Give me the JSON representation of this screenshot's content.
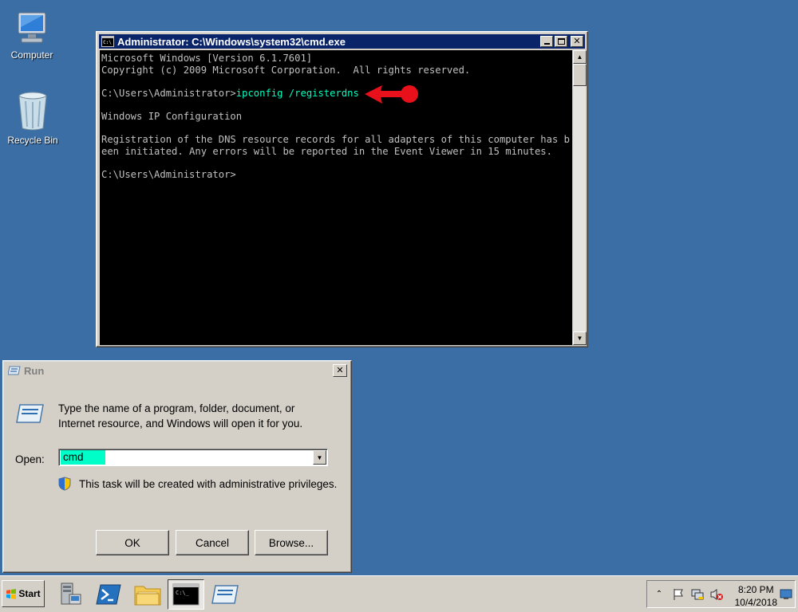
{
  "desktop": {
    "icons": [
      {
        "label": "Computer",
        "icon": "computer-icon"
      },
      {
        "label": "Recycle Bin",
        "icon": "recycle-bin-icon"
      }
    ]
  },
  "cmd_window": {
    "title": "Administrator: C:\\Windows\\system32\\cmd.exe",
    "lines": {
      "l1": "Microsoft Windows [Version 6.1.7601]",
      "l2": "Copyright (c) 2009 Microsoft Corporation.  All rights reserved.",
      "prompt1": "C:\\Users\\Administrator>",
      "command": "ipconfig /registerdns",
      "l4": "Windows IP Configuration",
      "l5": "Registration of the DNS resource records for all adapters of this computer has b",
      "l6": "een initiated. Any errors will be reported in the Event Viewer in 15 minutes.",
      "prompt2": "C:\\Users\\Administrator>"
    },
    "annotation_color": "#e8101a"
  },
  "run_dialog": {
    "title": "Run",
    "description_line1": "Type the name of a program, folder, document, or",
    "description_line2": "Internet resource, and Windows will open it for you.",
    "open_label": "Open:",
    "open_value": "cmd",
    "admin_note": "This task will be created with administrative privileges.",
    "ok_label": "OK",
    "cancel_label": "Cancel",
    "browse_label": "Browse..."
  },
  "taskbar": {
    "start_label": "Start",
    "buttons": [
      "server-manager-icon",
      "powershell-icon",
      "explorer-folder-icon",
      "cmd-icon",
      "run-icon"
    ],
    "clock": {
      "time": "8:20 PM",
      "date": "10/4/2018"
    }
  }
}
